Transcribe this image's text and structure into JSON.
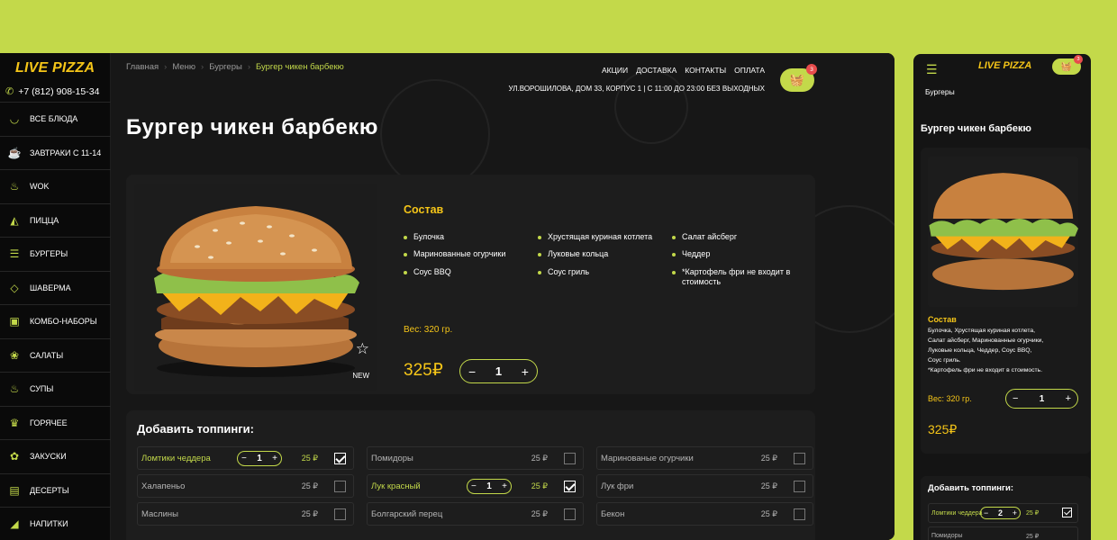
{
  "brand": {
    "logo": "LIVE PIZZA",
    "phone": "+7 (812) 908-15-34",
    "accent": "#c3d94a",
    "gold": "#f5c518"
  },
  "menu": [
    {
      "label": "ВСЕ БЛЮДА",
      "icon": "bowl-icon"
    },
    {
      "label": "ЗАВТРАКИ С 11-14",
      "icon": "breakfast-icon"
    },
    {
      "label": "WOK",
      "icon": "wok-icon"
    },
    {
      "label": "ПИЦЦА",
      "icon": "pizza-icon"
    },
    {
      "label": "БУРГЕРЫ",
      "icon": "burger-icon"
    },
    {
      "label": "ШАВЕРМА",
      "icon": "shawarma-icon"
    },
    {
      "label": "КОМБО-НАБОРЫ",
      "icon": "combo-icon"
    },
    {
      "label": "САЛАТЫ",
      "icon": "salad-icon"
    },
    {
      "label": "СУПЫ",
      "icon": "soup-icon"
    },
    {
      "label": "ГОРЯЧЕЕ",
      "icon": "hot-dish-icon"
    },
    {
      "label": "ЗАКУСКИ",
      "icon": "snack-icon"
    },
    {
      "label": "ДЕСЕРТЫ",
      "icon": "dessert-icon"
    },
    {
      "label": "НАПИТКИ",
      "icon": "drink-icon"
    }
  ],
  "breadcrumbs": [
    "Главная",
    "Меню",
    "Бургеры",
    "Бургер чикен барбекю"
  ],
  "topnav": [
    "АКЦИИ",
    "ДОСТАВКА",
    "КОНТАКТЫ",
    "ОПЛАТА"
  ],
  "address": "УЛ.ВОРОШИЛОВА, ДОМ 33, КОРПУС 1   |   С 11:00 ДО 23:00 БЕЗ ВЫХОДНЫХ",
  "cart_count": "3",
  "product": {
    "title": "Бургер чикен барбекю",
    "composition_title": "Состав",
    "ingredients": [
      "Булочка",
      "Хрустящая куриная котлета",
      "Салат айсберг",
      "Маринованные огурчики",
      "Луковые кольца",
      "Чеддер",
      "Соус BBQ",
      "Соус гриль",
      "*Картофель фри не входит в стоимость"
    ],
    "weight": "Вес: 320 гр.",
    "price": "325₽",
    "quantity": "1",
    "badge": "NEW"
  },
  "toppings": {
    "title": "Добавить топпинги:",
    "items": [
      {
        "name": "Ломтики чеддера",
        "price": "25 ₽",
        "qty": "1",
        "checked": true
      },
      {
        "name": "Помидоры",
        "price": "25 ₽",
        "checked": false
      },
      {
        "name": "Маринованые огурчики",
        "price": "25 ₽",
        "checked": false
      },
      {
        "name": "Халапеньо",
        "price": "25 ₽",
        "checked": false
      },
      {
        "name": "Лук красный",
        "price": "25 ₽",
        "qty": "1",
        "checked": true
      },
      {
        "name": "Лук фри",
        "price": "25 ₽",
        "checked": false
      },
      {
        "name": "Маслины",
        "price": "25 ₽",
        "checked": false
      },
      {
        "name": "Болгарский перец",
        "price": "25 ₽",
        "checked": false
      },
      {
        "name": "Бекон",
        "price": "25 ₽",
        "checked": false
      }
    ]
  },
  "mobile": {
    "logo": "LIVE PIZZA",
    "cart_count": "3",
    "crumb": "Бургеры",
    "title": "Бургер чикен барбекю",
    "composition_title": "Состав",
    "composition_lines": [
      "Булочка, Хрустящая куриная котлета,",
      "Салат айсберг, Маринованные огурчики,",
      "Луковые кольца, Чеддер, Соус BBQ,",
      "Соус гриль.",
      "*Картофель фри не входит в стоимость."
    ],
    "weight": "Вес: 320 гр.",
    "quantity": "1",
    "price": "325₽",
    "toppings_title": "Добавить топпинги:",
    "topping_first": {
      "name": "Ломтики чеддера",
      "qty": "2",
      "price": "25 ₽"
    },
    "topping_second": {
      "name": "Помидоры",
      "price": "25 ₽"
    }
  }
}
